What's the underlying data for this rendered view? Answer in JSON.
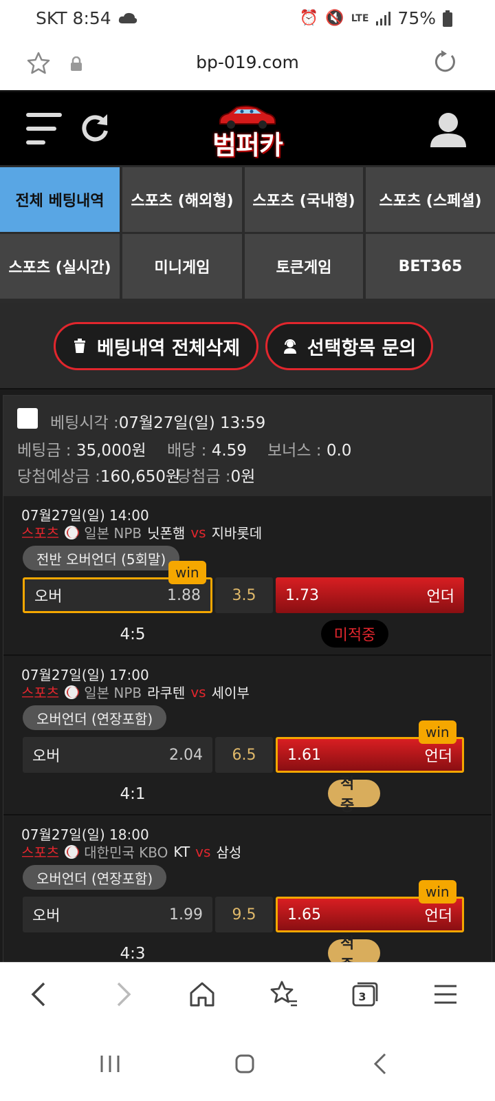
{
  "status_bar": {
    "carrier_time": "SKT 8:54",
    "battery": "75%"
  },
  "url_bar": {
    "url": "bp-019.com"
  },
  "header": {
    "logo_text": "범퍼카"
  },
  "tabs": [
    {
      "label": "전체 베팅내역",
      "active": true
    },
    {
      "label": "스포츠 (해외형)",
      "active": false
    },
    {
      "label": "스포츠 (국내형)",
      "active": false
    },
    {
      "label": "스포츠 (스페셜)",
      "active": false
    },
    {
      "label": "스포츠 (실시간)",
      "active": false
    },
    {
      "label": "미니게임",
      "active": false
    },
    {
      "label": "토큰게임",
      "active": false
    },
    {
      "label": "BET365",
      "active": false
    }
  ],
  "actions": {
    "delete_all": "베팅내역 전체삭제",
    "inquiry": "선택항목 문의"
  },
  "bet": {
    "bet_time_label": "베팅시각 :",
    "bet_time": "07월27일(일) 13:59",
    "amount_label": "베팅금 :",
    "amount": "35,000원",
    "odds_label": "배당 :",
    "odds": "4.59",
    "bonus_label": "보너스 :",
    "bonus": "0.0",
    "expected_label": "당첨예상금 :",
    "expected": "160,650원",
    "payout_label": "당첨금 :",
    "payout": "0원",
    "games": [
      {
        "datetime": "07월27일(일) 14:00",
        "sport": "스포츠",
        "league": "일본 NPB",
        "home": "닛폰햄",
        "vs": "vs",
        "away": "지바롯데",
        "market": "전반 오버언더 (5회말)",
        "left_label": "오버",
        "left_odd": "1.88",
        "line": "3.5",
        "right_odd": "1.73",
        "right_label": "언더",
        "selected": "left",
        "win_tag": "win",
        "score": "4:5",
        "result": "미적중"
      },
      {
        "datetime": "07월27일(일) 17:00",
        "sport": "스포츠",
        "league": "일본 NPB",
        "home": "라쿠텐",
        "vs": "vs",
        "away": "세이부",
        "market": "오버언더 (연장포함)",
        "left_label": "오버",
        "left_odd": "2.04",
        "line": "6.5",
        "right_odd": "1.61",
        "right_label": "언더",
        "selected": "right",
        "win_tag": "win",
        "score": "4:1",
        "result": "적중"
      },
      {
        "datetime": "07월27일(일) 18:00",
        "sport": "스포츠",
        "league": "대한민국 KBO",
        "home": "KT",
        "vs": "vs",
        "away": "삼성",
        "market": "오버언더 (연장포함)",
        "left_label": "오버",
        "left_odd": "1.99",
        "line": "9.5",
        "right_odd": "1.65",
        "right_label": "언더",
        "selected": "right",
        "win_tag": "win",
        "score": "4:3",
        "result": "적중"
      }
    ]
  },
  "browser_nav": {
    "tab_count": "3"
  }
}
